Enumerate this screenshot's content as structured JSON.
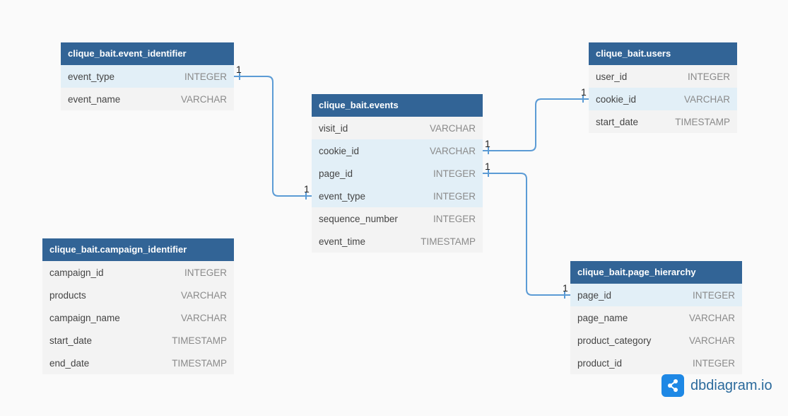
{
  "tables": [
    {
      "id": "event_identifier",
      "name": "clique_bait.event_identifier",
      "fields": [
        {
          "name": "event_type",
          "type": "INTEGER",
          "highlight": true
        },
        {
          "name": "event_name",
          "type": "VARCHAR",
          "highlight": false
        }
      ]
    },
    {
      "id": "users",
      "name": "clique_bait.users",
      "fields": [
        {
          "name": "user_id",
          "type": "INTEGER",
          "highlight": false
        },
        {
          "name": "cookie_id",
          "type": "VARCHAR",
          "highlight": true
        },
        {
          "name": "start_date",
          "type": "TIMESTAMP",
          "highlight": false
        }
      ]
    },
    {
      "id": "events",
      "name": "clique_bait.events",
      "fields": [
        {
          "name": "visit_id",
          "type": "VARCHAR",
          "highlight": false
        },
        {
          "name": "cookie_id",
          "type": "VARCHAR",
          "highlight": true
        },
        {
          "name": "page_id",
          "type": "INTEGER",
          "highlight": true
        },
        {
          "name": "event_type",
          "type": "INTEGER",
          "highlight": true
        },
        {
          "name": "sequence_number",
          "type": "INTEGER",
          "highlight": false
        },
        {
          "name": "event_time",
          "type": "TIMESTAMP",
          "highlight": false
        }
      ]
    },
    {
      "id": "campaign_identifier",
      "name": "clique_bait.campaign_identifier",
      "fields": [
        {
          "name": "campaign_id",
          "type": "INTEGER",
          "highlight": false
        },
        {
          "name": "products",
          "type": "VARCHAR",
          "highlight": false
        },
        {
          "name": "campaign_name",
          "type": "VARCHAR",
          "highlight": false
        },
        {
          "name": "start_date",
          "type": "TIMESTAMP",
          "highlight": false
        },
        {
          "name": "end_date",
          "type": "TIMESTAMP",
          "highlight": false
        }
      ]
    },
    {
      "id": "page_hierarchy",
      "name": "clique_bait.page_hierarchy",
      "fields": [
        {
          "name": "page_id",
          "type": "INTEGER",
          "highlight": true
        },
        {
          "name": "page_name",
          "type": "VARCHAR",
          "highlight": false
        },
        {
          "name": "product_category",
          "type": "VARCHAR",
          "highlight": false
        },
        {
          "name": "product_id",
          "type": "INTEGER",
          "highlight": false
        }
      ]
    }
  ],
  "relationships": [
    {
      "from": "event_identifier.event_type",
      "to": "events.event_type",
      "from_label": "1",
      "to_label": "1"
    },
    {
      "from": "events.cookie_id",
      "to": "users.cookie_id",
      "from_label": "1",
      "to_label": "1"
    },
    {
      "from": "events.page_id",
      "to": "page_hierarchy.page_id",
      "from_label": "1",
      "to_label": "1"
    }
  ],
  "colors": {
    "header": "#326496",
    "row": "#f3f3f3",
    "row_highlight": "#e2eff7",
    "link": "#5b9bd5"
  },
  "brand": {
    "text": "dbdiagram.io",
    "icon": "share-nodes-icon"
  }
}
